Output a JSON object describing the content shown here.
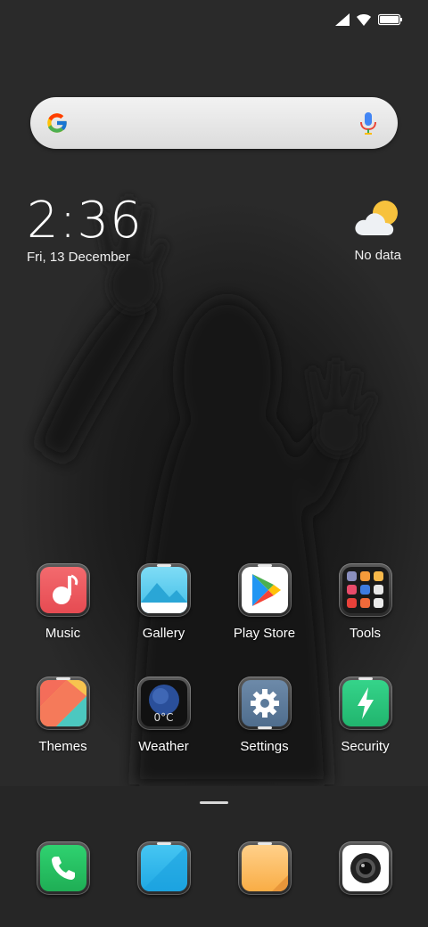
{
  "status_bar": {
    "signal_icon": "cellular-signal-icon",
    "wifi_icon": "wifi-icon",
    "battery_icon": "battery-icon"
  },
  "search": {
    "logo_icon": "google-g-logo-icon",
    "mic_icon": "microphone-icon"
  },
  "clock": {
    "time": "2:36",
    "date": "Fri, 13 December"
  },
  "weather_widget": {
    "icon": "partly-cloudy-icon",
    "text": "No data"
  },
  "apps": [
    {
      "label": "Music",
      "icon": "music-note-icon",
      "color": "#f0595e"
    },
    {
      "label": "Gallery",
      "icon": "gallery-mountains-icon",
      "color": "#4cc6ec"
    },
    {
      "label": "Play Store",
      "icon": "play-store-icon",
      "color": "#ffffff"
    },
    {
      "label": "Tools",
      "icon": "tools-folder-icon",
      "color": "#1c1c1c"
    },
    {
      "label": "Themes",
      "icon": "themes-icon",
      "color": "#f46d5a"
    },
    {
      "label": "Weather",
      "icon": "weather-globe-icon",
      "text": "0°C",
      "color": "#1a2a55"
    },
    {
      "label": "Settings",
      "icon": "gear-icon",
      "color": "#5b7a9a"
    },
    {
      "label": "Security",
      "icon": "lightning-shield-icon",
      "color": "#27c27a"
    }
  ],
  "dock": {
    "page_indicator": "page-indicator",
    "apps": [
      {
        "icon": "phone-icon",
        "color": "#27c060"
      },
      {
        "icon": "messages-icon",
        "color": "#2bb4ea"
      },
      {
        "icon": "notes-icon",
        "color": "#fbb855"
      },
      {
        "icon": "camera-icon",
        "color": "#ffffff"
      }
    ]
  }
}
